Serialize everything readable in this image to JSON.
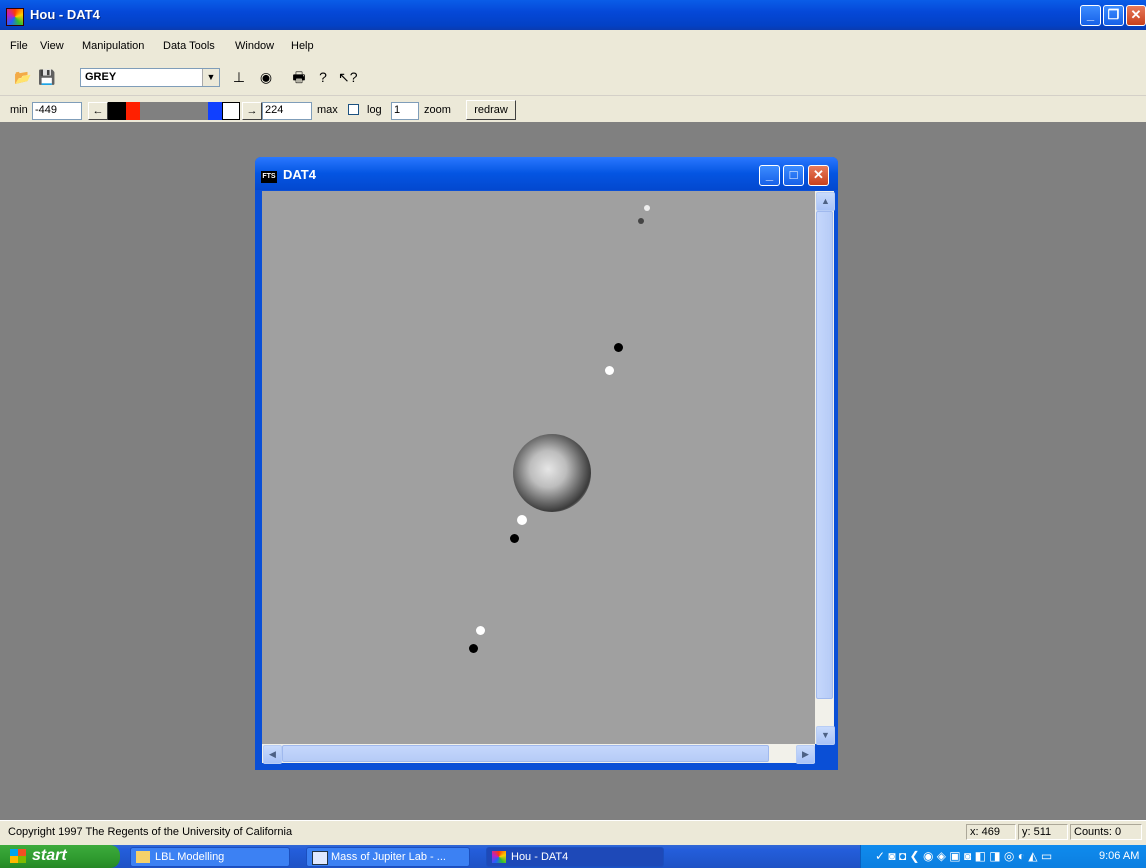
{
  "app": {
    "title": "Hou - DAT4"
  },
  "menu": [
    "File",
    "View",
    "Manipulation",
    "Data Tools",
    "Window",
    "Help"
  ],
  "toolbar": {
    "colormap": "GREY",
    "icons": [
      "open-icon",
      "save-icon",
      "cursor-icon",
      "target-icon",
      "print-icon",
      "help-icon",
      "context-help-icon"
    ]
  },
  "range": {
    "min_label": "min",
    "min_value": "-449",
    "max_value": "224",
    "max_label": "max",
    "log_label": "log",
    "log_checked": false,
    "zoom_value": "1",
    "zoom_label": "zoom",
    "redraw_label": "redraw",
    "colors": {
      "left_black": "#000000",
      "left_red": "#ff2000",
      "right_blue": "#1040ff",
      "right_white": "#ffffff"
    }
  },
  "child_window": {
    "title": "DAT4",
    "icon_text": "FTS"
  },
  "status": {
    "copyright": "Copyright 1997 The Regents of the University of California",
    "x": "x: 469",
    "y": "y: 511",
    "counts": "Counts: 0"
  },
  "taskbar": {
    "start_label": "start",
    "tasks": [
      "LBL Modelling",
      "Mass of Jupiter Lab - ...",
      "Hou - DAT4"
    ],
    "clock": "9:06 AM"
  }
}
